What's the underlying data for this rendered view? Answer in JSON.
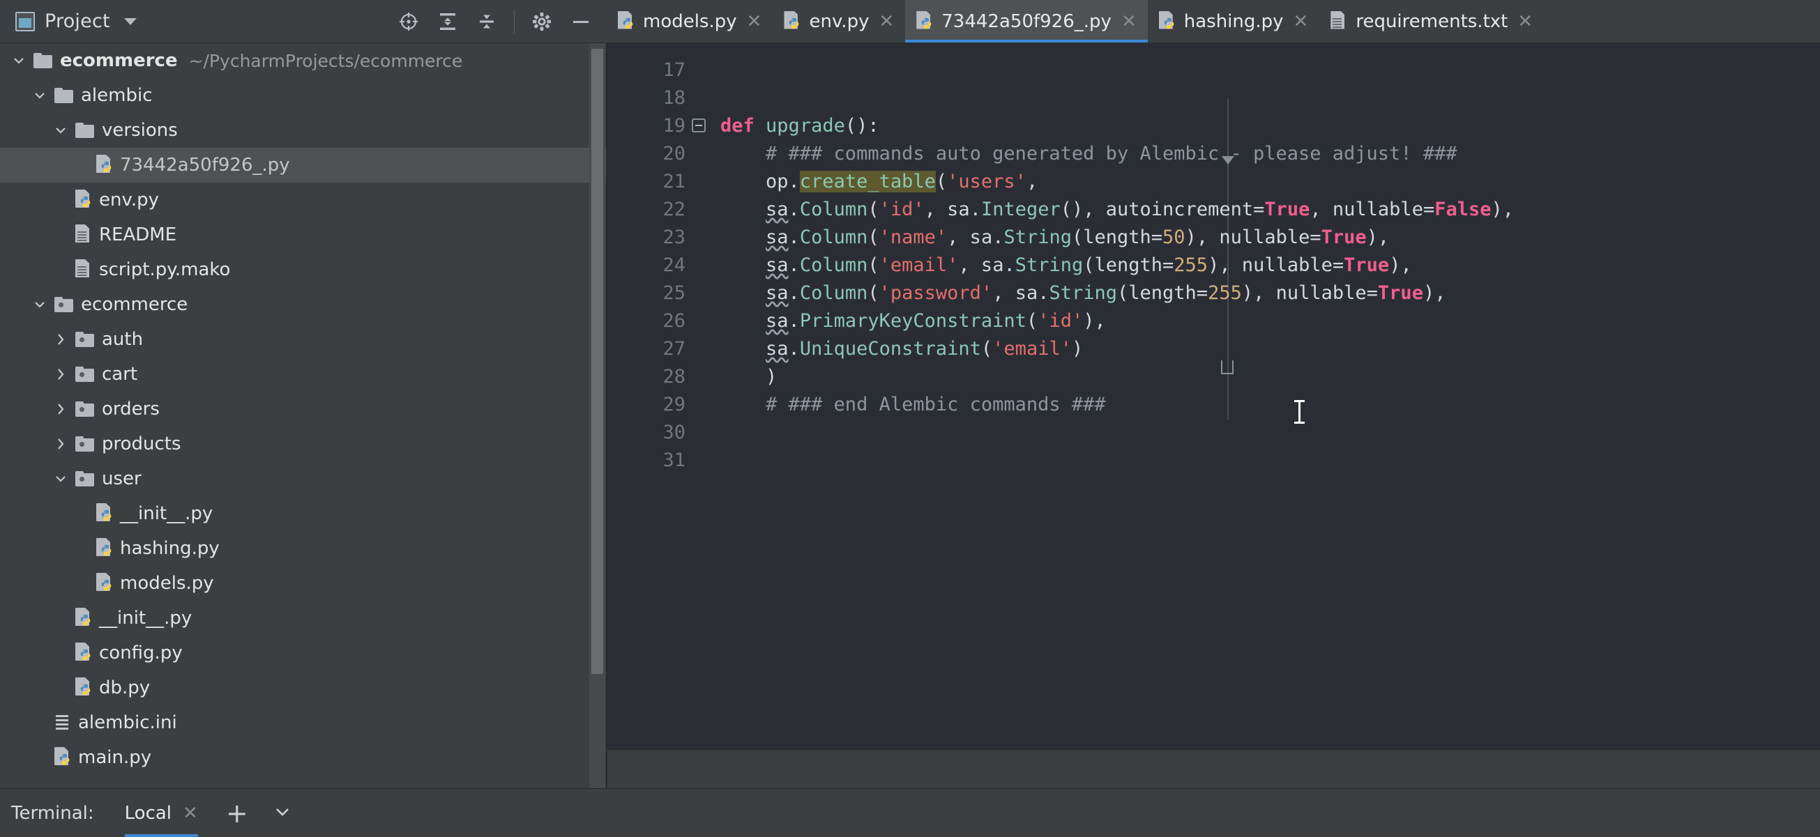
{
  "project_panel": {
    "title": "Project",
    "icon": "project-window-icon",
    "dropdown_icon": "chevron-down-icon",
    "toolbar": [
      {
        "name": "locate-file-icon",
        "label": "Select Opened File"
      },
      {
        "name": "expand-all-icon",
        "label": "Expand All"
      },
      {
        "name": "collapse-all-icon",
        "label": "Collapse All"
      },
      {
        "name": "settings-gear-icon",
        "label": "Options"
      },
      {
        "name": "hide-panel-icon",
        "label": "Hide"
      }
    ],
    "tree": [
      {
        "name": "ecommerce",
        "path": "~/PycharmProjects/ecommerce",
        "type": "folder",
        "indent": 0,
        "state": "expanded",
        "bold": true,
        "selected": false
      },
      {
        "name": "alembic",
        "path": "",
        "type": "folder",
        "indent": 1,
        "state": "expanded",
        "bold": false,
        "selected": false
      },
      {
        "name": "versions",
        "path": "",
        "type": "folder",
        "indent": 2,
        "state": "expanded",
        "bold": false,
        "selected": false
      },
      {
        "name": "73442a50f926_.py",
        "path": "",
        "type": "python",
        "indent": 3,
        "state": "leaf",
        "bold": false,
        "selected": true
      },
      {
        "name": "env.py",
        "path": "",
        "type": "python",
        "indent": 2,
        "state": "leaf",
        "bold": false,
        "selected": false
      },
      {
        "name": "README",
        "path": "",
        "type": "text",
        "indent": 2,
        "state": "leaf",
        "bold": false,
        "selected": false
      },
      {
        "name": "script.py.mako",
        "path": "",
        "type": "text",
        "indent": 2,
        "state": "leaf",
        "bold": false,
        "selected": false
      },
      {
        "name": "ecommerce",
        "path": "",
        "type": "module",
        "indent": 1,
        "state": "expanded",
        "bold": false,
        "selected": false
      },
      {
        "name": "auth",
        "path": "",
        "type": "module",
        "indent": 2,
        "state": "collapsed",
        "bold": false,
        "selected": false
      },
      {
        "name": "cart",
        "path": "",
        "type": "module",
        "indent": 2,
        "state": "collapsed",
        "bold": false,
        "selected": false
      },
      {
        "name": "orders",
        "path": "",
        "type": "module",
        "indent": 2,
        "state": "collapsed",
        "bold": false,
        "selected": false
      },
      {
        "name": "products",
        "path": "",
        "type": "module",
        "indent": 2,
        "state": "collapsed",
        "bold": false,
        "selected": false
      },
      {
        "name": "user",
        "path": "",
        "type": "module",
        "indent": 2,
        "state": "expanded",
        "bold": false,
        "selected": false
      },
      {
        "name": "__init__.py",
        "path": "",
        "type": "python",
        "indent": 3,
        "state": "leaf",
        "bold": false,
        "selected": false
      },
      {
        "name": "hashing.py",
        "path": "",
        "type": "python",
        "indent": 3,
        "state": "leaf",
        "bold": false,
        "selected": false
      },
      {
        "name": "models.py",
        "path": "",
        "type": "python",
        "indent": 3,
        "state": "leaf",
        "bold": false,
        "selected": false
      },
      {
        "name": "__init__.py",
        "path": "",
        "type": "python",
        "indent": 2,
        "state": "leaf",
        "bold": false,
        "selected": false
      },
      {
        "name": "config.py",
        "path": "",
        "type": "python",
        "indent": 2,
        "state": "leaf",
        "bold": false,
        "selected": false
      },
      {
        "name": "db.py",
        "path": "",
        "type": "python",
        "indent": 2,
        "state": "leaf",
        "bold": false,
        "selected": false
      },
      {
        "name": "alembic.ini",
        "path": "",
        "type": "ini",
        "indent": 1,
        "state": "leaf",
        "bold": false,
        "selected": false
      },
      {
        "name": "main.py",
        "path": "",
        "type": "python",
        "indent": 1,
        "state": "leaf",
        "bold": false,
        "selected": false
      }
    ]
  },
  "editor_tabs": [
    {
      "label": "models.py",
      "icon": "python-file-icon",
      "active": false,
      "closable": true
    },
    {
      "label": "env.py",
      "icon": "python-file-icon",
      "active": false,
      "closable": true
    },
    {
      "label": "73442a50f926_.py",
      "icon": "python-file-icon",
      "active": true,
      "closable": true
    },
    {
      "label": "hashing.py",
      "icon": "python-file-icon",
      "active": false,
      "closable": true
    },
    {
      "label": "requirements.txt",
      "icon": "text-file-icon",
      "active": false,
      "closable": true
    }
  ],
  "editor": {
    "first_line": 17,
    "lines": [
      {
        "no": 17,
        "tokens": []
      },
      {
        "no": 18,
        "tokens": []
      },
      {
        "no": 19,
        "fold": "start",
        "tokens": [
          {
            "t": "def",
            "c": "kw"
          },
          {
            "t": " ",
            "c": "plain"
          },
          {
            "t": "upgrade",
            "c": "fn"
          },
          {
            "t": "():",
            "c": "plain"
          }
        ]
      },
      {
        "no": 20,
        "tokens": [
          {
            "t": "    # ### commands auto generated by Alembic - please adjust! ###",
            "c": "cmt"
          }
        ]
      },
      {
        "no": 21,
        "tokens": [
          {
            "t": "    op.",
            "c": "plain"
          },
          {
            "t": "create_table",
            "c": "fn hl"
          },
          {
            "t": "(",
            "c": "plain"
          },
          {
            "t": "'users'",
            "c": "str"
          },
          {
            "t": ",",
            "c": "plain"
          }
        ]
      },
      {
        "no": 22,
        "tokens": [
          {
            "t": "    ",
            "c": "plain"
          },
          {
            "t": "sa",
            "c": "plain sqg"
          },
          {
            "t": ".",
            "c": "plain"
          },
          {
            "t": "Column",
            "c": "cls"
          },
          {
            "t": "(",
            "c": "plain"
          },
          {
            "t": "'id'",
            "c": "str"
          },
          {
            "t": ", ",
            "c": "plain"
          },
          {
            "t": "sa",
            "c": "plain"
          },
          {
            "t": ".",
            "c": "plain"
          },
          {
            "t": "Integer",
            "c": "cls"
          },
          {
            "t": "(), autoincrement=",
            "c": "plain"
          },
          {
            "t": "True",
            "c": "kw"
          },
          {
            "t": ", nullable=",
            "c": "plain"
          },
          {
            "t": "False",
            "c": "kw"
          },
          {
            "t": "),",
            "c": "plain"
          }
        ]
      },
      {
        "no": 23,
        "tokens": [
          {
            "t": "    ",
            "c": "plain"
          },
          {
            "t": "sa",
            "c": "plain sqg"
          },
          {
            "t": ".",
            "c": "plain"
          },
          {
            "t": "Column",
            "c": "cls"
          },
          {
            "t": "(",
            "c": "plain"
          },
          {
            "t": "'name'",
            "c": "str"
          },
          {
            "t": ", sa.",
            "c": "plain"
          },
          {
            "t": "String",
            "c": "cls"
          },
          {
            "t": "(length=",
            "c": "plain"
          },
          {
            "t": "50",
            "c": "num"
          },
          {
            "t": "), nullable=",
            "c": "plain"
          },
          {
            "t": "True",
            "c": "kw"
          },
          {
            "t": "),",
            "c": "plain"
          }
        ]
      },
      {
        "no": 24,
        "tokens": [
          {
            "t": "    ",
            "c": "plain"
          },
          {
            "t": "sa",
            "c": "plain sqg"
          },
          {
            "t": ".",
            "c": "plain"
          },
          {
            "t": "Column",
            "c": "cls"
          },
          {
            "t": "(",
            "c": "plain"
          },
          {
            "t": "'email'",
            "c": "str"
          },
          {
            "t": ", sa.",
            "c": "plain"
          },
          {
            "t": "String",
            "c": "cls"
          },
          {
            "t": "(length=",
            "c": "plain"
          },
          {
            "t": "255",
            "c": "num"
          },
          {
            "t": "), nullable=",
            "c": "plain"
          },
          {
            "t": "True",
            "c": "kw"
          },
          {
            "t": "),",
            "c": "plain"
          }
        ]
      },
      {
        "no": 25,
        "tokens": [
          {
            "t": "    ",
            "c": "plain"
          },
          {
            "t": "sa",
            "c": "plain sqg"
          },
          {
            "t": ".",
            "c": "plain"
          },
          {
            "t": "Column",
            "c": "cls"
          },
          {
            "t": "(",
            "c": "plain"
          },
          {
            "t": "'password'",
            "c": "str"
          },
          {
            "t": ", sa.",
            "c": "plain"
          },
          {
            "t": "String",
            "c": "cls"
          },
          {
            "t": "(length=",
            "c": "plain"
          },
          {
            "t": "255",
            "c": "num"
          },
          {
            "t": "), nullable=",
            "c": "plain"
          },
          {
            "t": "True",
            "c": "kw"
          },
          {
            "t": "),",
            "c": "plain"
          }
        ]
      },
      {
        "no": 26,
        "tokens": [
          {
            "t": "    ",
            "c": "plain"
          },
          {
            "t": "sa",
            "c": "plain sqg"
          },
          {
            "t": ".",
            "c": "plain"
          },
          {
            "t": "PrimaryKeyConstraint",
            "c": "cls"
          },
          {
            "t": "(",
            "c": "plain"
          },
          {
            "t": "'id'",
            "c": "str"
          },
          {
            "t": "),",
            "c": "plain"
          }
        ]
      },
      {
        "no": 27,
        "tokens": [
          {
            "t": "    ",
            "c": "plain"
          },
          {
            "t": "sa",
            "c": "plain sqg"
          },
          {
            "t": ".",
            "c": "plain"
          },
          {
            "t": "UniqueConstraint",
            "c": "cls"
          },
          {
            "t": "(",
            "c": "plain"
          },
          {
            "t": "'email'",
            "c": "str"
          },
          {
            "t": ")",
            "c": "plain"
          }
        ]
      },
      {
        "no": 28,
        "tokens": [
          {
            "t": "    )",
            "c": "plain"
          }
        ]
      },
      {
        "no": 29,
        "fold": "end",
        "tokens": [
          {
            "t": "    # ### end Alembic commands ###",
            "c": "cmt"
          }
        ]
      },
      {
        "no": 30,
        "tokens": []
      },
      {
        "no": 31,
        "tokens": []
      }
    ]
  },
  "terminal": {
    "label": "Terminal:",
    "tabs": [
      {
        "label": "Local",
        "active": true,
        "closable": true
      }
    ],
    "add_icon": "plus-icon",
    "menu_icon": "chevron-down-icon"
  },
  "colors": {
    "accent": "#3d89d6",
    "editor_bg": "#2b2d35",
    "panel_bg": "#3c3f41",
    "selection_bg": "#4e5254",
    "keyword": "#ef5f8c",
    "function": "#8cc8b4",
    "string": "#e2706b",
    "number": "#cfae7a",
    "comment": "#8f949e",
    "highlight": "#5c5a2e"
  }
}
